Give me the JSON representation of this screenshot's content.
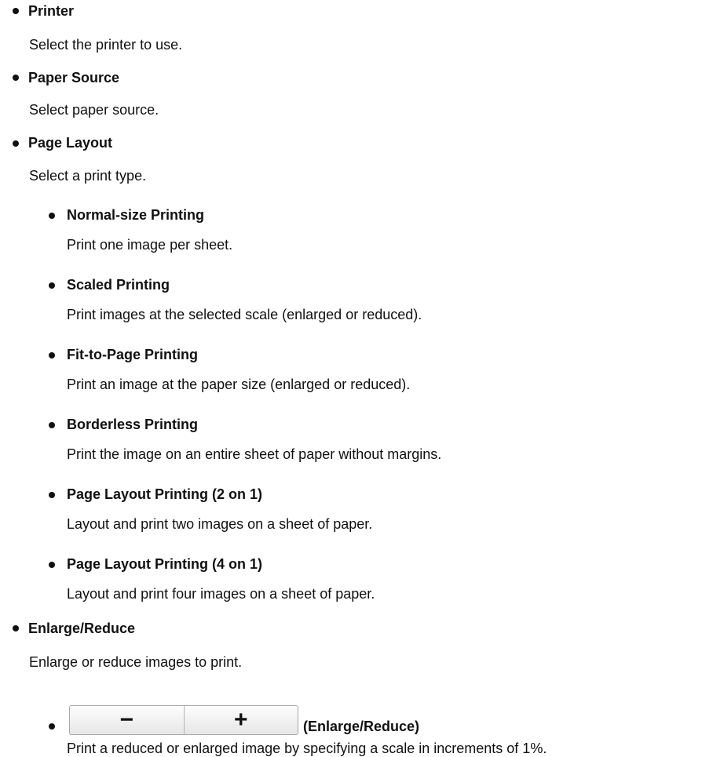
{
  "items": [
    {
      "title": "Printer",
      "desc": "Select the printer to use."
    },
    {
      "title": "Paper Source",
      "desc": "Select paper source."
    },
    {
      "title": "Page Layout",
      "desc": "Select a print type.",
      "subitems": [
        {
          "title": "Normal-size Printing",
          "desc": "Print one image per sheet."
        },
        {
          "title": "Scaled Printing",
          "desc": "Print images at the selected scale (enlarged or reduced)."
        },
        {
          "title": "Fit-to-Page Printing",
          "desc": "Print an image at the paper size (enlarged or reduced)."
        },
        {
          "title": "Borderless Printing",
          "desc": "Print the image on an entire sheet of paper without margins."
        },
        {
          "title": "Page Layout Printing (2 on 1)",
          "desc": "Layout and print two images on a sheet of paper."
        },
        {
          "title": "Page Layout Printing (4 on 1)",
          "desc": "Layout and print four images on a sheet of paper."
        }
      ]
    },
    {
      "title": "Enlarge/Reduce",
      "desc": "Enlarge or reduce images to print.",
      "control": {
        "minus_label": "−",
        "plus_label": "+",
        "caption": "(Enlarge/Reduce)",
        "desc": "Print a reduced or enlarged image by specifying a scale in increments of 1%."
      }
    }
  ]
}
